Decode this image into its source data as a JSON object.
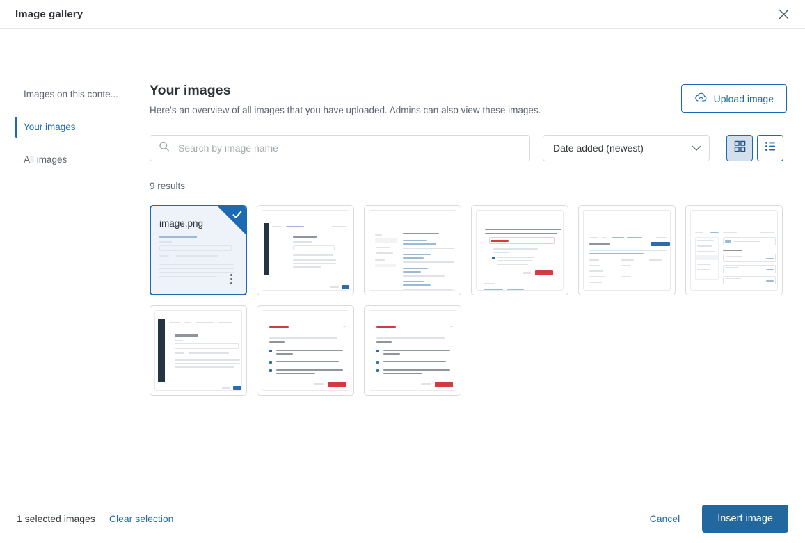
{
  "window": {
    "title": "Image gallery",
    "close_icon": "close-icon"
  },
  "sidebar": {
    "items": [
      {
        "label": "Images on this conte...",
        "active": false
      },
      {
        "label": "Your images",
        "active": true
      },
      {
        "label": "All images",
        "active": false
      }
    ]
  },
  "main": {
    "title": "Your images",
    "subtitle": "Here's an overview of all images that you have uploaded. Admins can also view these images.",
    "upload_button": {
      "label": "Upload image",
      "icon": "cloud-upload-icon"
    },
    "search": {
      "placeholder": "Search by image name",
      "value": "",
      "icon": "search-icon"
    },
    "sort": {
      "value": "Date added (newest)",
      "icon": "chevron-down-icon"
    },
    "view_toggle": {
      "grid": {
        "name": "grid-view",
        "active": true,
        "icon": "grid-icon"
      },
      "list": {
        "name": "list-view",
        "active": false,
        "icon": "list-icon"
      }
    },
    "results_text": "9 results",
    "images": [
      {
        "name": "image.png",
        "selected": true,
        "kind": "doc-form"
      },
      {
        "name": "",
        "selected": false,
        "kind": "app-sidebar-form"
      },
      {
        "name": "",
        "selected": false,
        "kind": "list-links"
      },
      {
        "name": "",
        "selected": false,
        "kind": "dialog-red"
      },
      {
        "name": "",
        "selected": false,
        "kind": "table-page"
      },
      {
        "name": "",
        "selected": false,
        "kind": "settings-page"
      },
      {
        "name": "",
        "selected": false,
        "kind": "app-sidebar-editor"
      },
      {
        "name": "",
        "selected": false,
        "kind": "delete-dialog"
      },
      {
        "name": "",
        "selected": false,
        "kind": "delete-dialog"
      }
    ]
  },
  "footer": {
    "selected_text": "1 selected images",
    "clear_label": "Clear selection",
    "cancel_label": "Cancel",
    "insert_label": "Insert image"
  },
  "colors": {
    "accent": "#1c6ab1",
    "primary_button": "#23679f",
    "text": "#32373d",
    "muted": "#5a6472",
    "border": "#d8dbde"
  }
}
